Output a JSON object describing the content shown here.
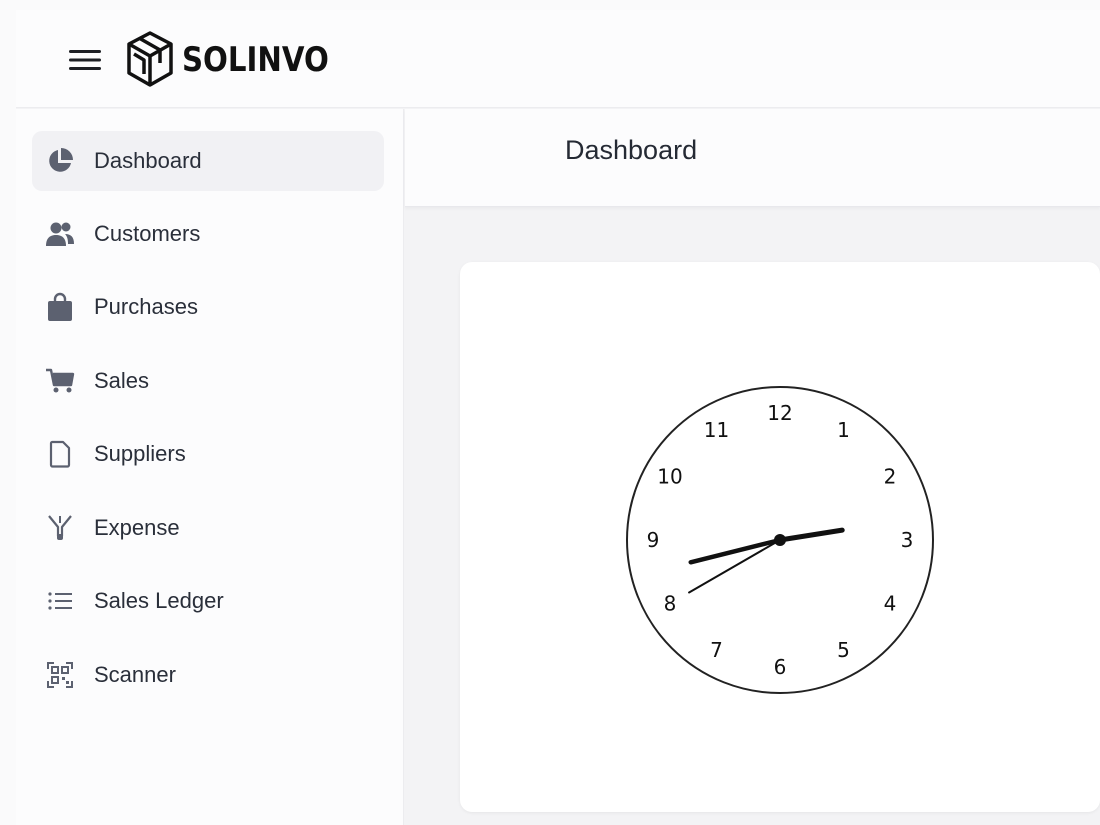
{
  "brand": {
    "name": "SOLINVO",
    "menu_icon": "hamburger-menu-icon",
    "logo_icon": "cube-logo-icon"
  },
  "sidebar": {
    "items": [
      {
        "label": "Dashboard",
        "icon": "pie-chart-icon",
        "active": true
      },
      {
        "label": "Customers",
        "icon": "users-icon",
        "active": false
      },
      {
        "label": "Purchases",
        "icon": "shopping-bag-icon",
        "active": false
      },
      {
        "label": "Sales",
        "icon": "cart-icon",
        "active": false
      },
      {
        "label": "Suppliers",
        "icon": "document-icon",
        "active": false
      },
      {
        "label": "Expense",
        "icon": "funnel-icon",
        "active": false
      },
      {
        "label": "Sales Ledger",
        "icon": "list-icon",
        "active": false
      },
      {
        "label": "Scanner",
        "icon": "qr-scan-icon",
        "active": false
      }
    ]
  },
  "header": {
    "title": "Dashboard"
  },
  "clock": {
    "numerals": [
      "12",
      "1",
      "2",
      "3",
      "4",
      "5",
      "6",
      "7",
      "8",
      "9",
      "10",
      "11"
    ],
    "time": {
      "hours": 2,
      "minutes": 42,
      "seconds": 40
    }
  },
  "colors": {
    "accent_bg": "#f1f1f4",
    "icon": "#5c6170",
    "text": "#2a2f3a"
  }
}
